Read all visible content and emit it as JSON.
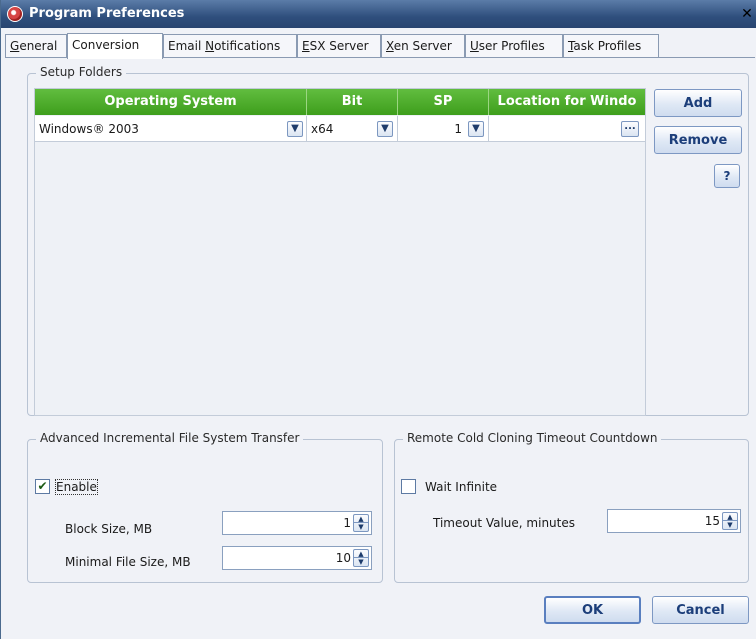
{
  "window": {
    "title": "Program Preferences",
    "close_glyph": "✕"
  },
  "tabs": [
    {
      "label": "General",
      "mnemonic": "G",
      "rest": "eneral"
    },
    {
      "label": "Conversion",
      "mnemonic": "",
      "rest": "Conversion",
      "active": true
    },
    {
      "label": "Email Notifications",
      "pre": "Email ",
      "mnemonic": "N",
      "rest": "otifications"
    },
    {
      "label": "ESX Server",
      "mnemonic": "E",
      "rest": "SX Server"
    },
    {
      "label": "Xen Server",
      "mnemonic": "X",
      "rest": "en Server"
    },
    {
      "label": "User Profiles",
      "mnemonic": "U",
      "rest": "ser Profiles"
    },
    {
      "label": "Task Profiles",
      "mnemonic": "T",
      "rest": "ask Profiles"
    }
  ],
  "setup_folders": {
    "title": "Setup Folders",
    "columns": [
      "Operating System",
      "Bit",
      "SP",
      "Location for Windo"
    ],
    "rows": [
      {
        "os": "Windows® 2003",
        "bit": "x64",
        "sp": "1",
        "location": ""
      }
    ],
    "add_label": "Add",
    "remove_label": "Remove",
    "help_label": "?",
    "browse_label": "..."
  },
  "incremental": {
    "title": "Advanced Incremental File System Transfer",
    "enable_label": "Enable",
    "enable_checked": true,
    "block_size_label": "Block Size, MB",
    "block_size_value": "1",
    "min_file_label": "Minimal File Size, MB",
    "min_file_value": "10"
  },
  "cold_cloning": {
    "title": "Remote Cold Cloning Timeout Countdown",
    "wait_label": "Wait Infinite",
    "wait_checked": false,
    "timeout_label": "Timeout Value, minutes",
    "timeout_value": "15"
  },
  "footer": {
    "ok_label": "OK",
    "cancel_label": "Cancel"
  },
  "colors": {
    "grid_header": "#4caa2a",
    "titlebar": "#2f4f7d",
    "button_text": "#1c3e7a"
  }
}
